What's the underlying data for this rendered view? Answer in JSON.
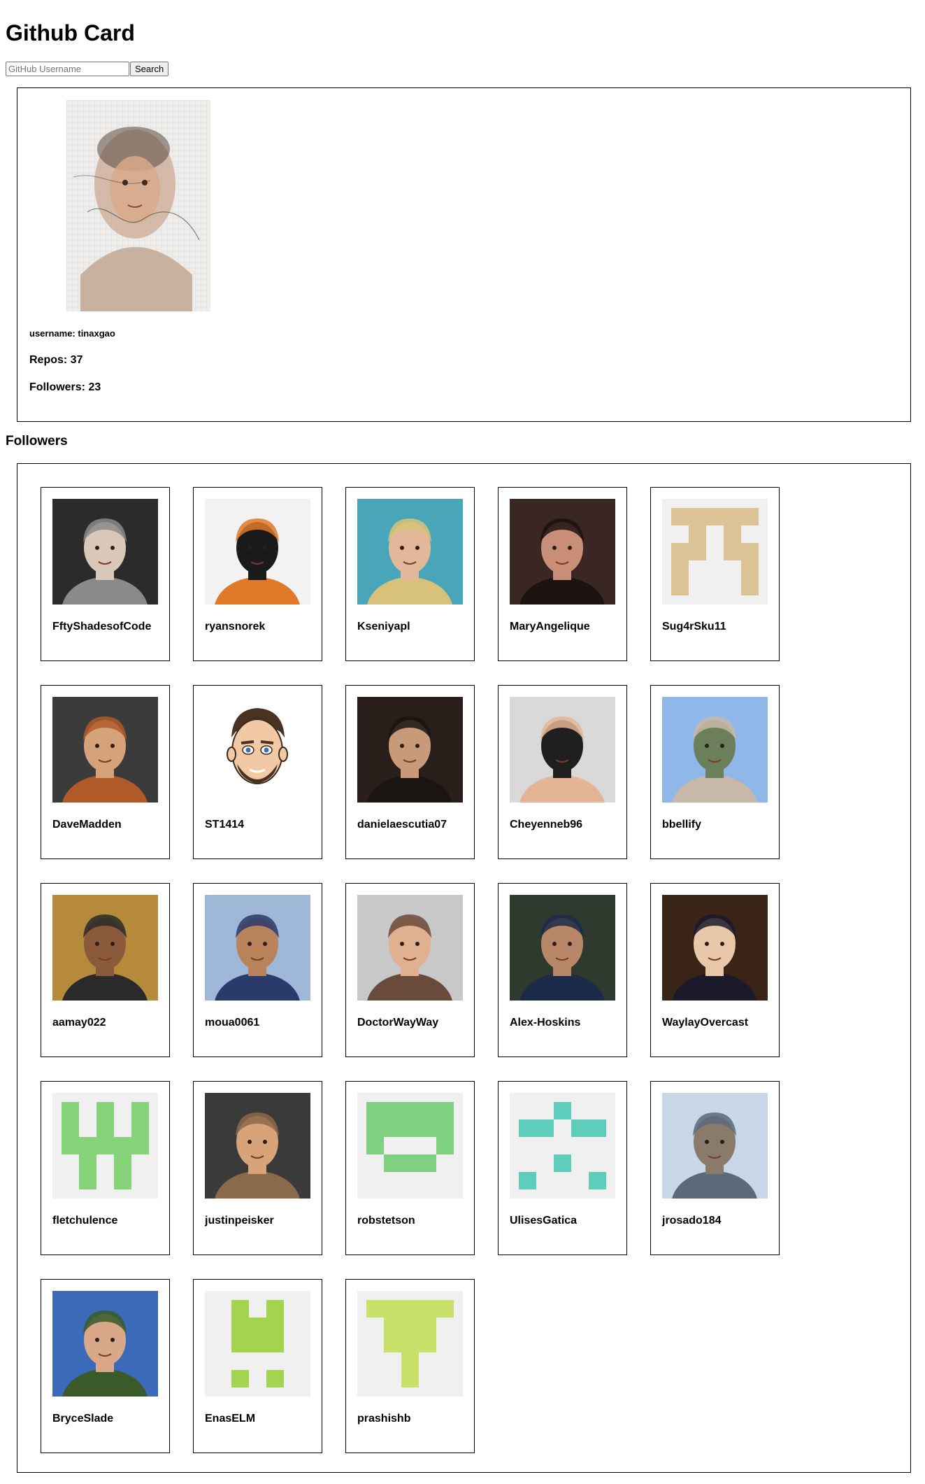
{
  "app": {
    "title": "Github Card"
  },
  "search": {
    "placeholder": "GitHub Username",
    "value": "",
    "button_label": "Search"
  },
  "profile": {
    "username_text": "username: tinaxgao",
    "repos_text": "Repos: 37",
    "followers_text": "Followers: 23"
  },
  "followers_section": {
    "heading": "Followers"
  },
  "followers": [
    {
      "login": "FftyShadesofCode",
      "avatar": "photo",
      "colors": [
        "#2b2b2b",
        "#d9c8b8",
        "#8a8a8a"
      ]
    },
    {
      "login": "ryansnorek",
      "avatar": "photo",
      "colors": [
        "#f2f2f2",
        "#1a1a1a",
        "#e07a2a"
      ]
    },
    {
      "login": "Kseniyapl",
      "avatar": "photo",
      "colors": [
        "#49a6b8",
        "#e2b89a",
        "#d8c27a"
      ]
    },
    {
      "login": "MaryAngelique",
      "avatar": "photo",
      "colors": [
        "#3a2622",
        "#c98e78",
        "#1c1210"
      ]
    },
    {
      "login": "Sug4rSku11",
      "avatar": "identicon",
      "colors": [
        "#f0f0f0",
        "#dcc396"
      ]
    },
    {
      "login": "DaveMadden",
      "avatar": "photo",
      "colors": [
        "#3b3b3b",
        "#d6a27a",
        "#b05a2a"
      ]
    },
    {
      "login": "ST1414",
      "avatar": "cartoon",
      "colors": [
        "#ffffff",
        "#f2c9a5",
        "#4a3222"
      ]
    },
    {
      "login": "danielaescutia07",
      "avatar": "photo",
      "colors": [
        "#2a1e1a",
        "#c89a7a",
        "#1a1412"
      ]
    },
    {
      "login": "Cheyenneb96",
      "avatar": "photo",
      "colors": [
        "#d9d9d9",
        "#1f1f1f",
        "#e3b596"
      ]
    },
    {
      "login": "bbellify",
      "avatar": "photo",
      "colors": [
        "#8fb7e8",
        "#6a7f5a",
        "#c8b8a8"
      ]
    },
    {
      "login": "aamay022",
      "avatar": "photo",
      "colors": [
        "#b58a3a",
        "#8a5a3a",
        "#2a2a2a"
      ]
    },
    {
      "login": "moua0061",
      "avatar": "photo",
      "colors": [
        "#9fb8d8",
        "#b8825a",
        "#2a3a6a"
      ]
    },
    {
      "login": "DoctorWayWay",
      "avatar": "photo",
      "colors": [
        "#c8c8c8",
        "#e0b090",
        "#6a4a3a"
      ]
    },
    {
      "login": "Alex-Hoskins",
      "avatar": "photo",
      "colors": [
        "#2e3a2e",
        "#b8876a",
        "#1c2a4a"
      ]
    },
    {
      "login": "WaylayOvercast",
      "avatar": "photo",
      "colors": [
        "#3a2418",
        "#e8c8a8",
        "#1a1a2a"
      ]
    },
    {
      "login": "fletchulence",
      "avatar": "identicon",
      "colors": [
        "#f0f0f0",
        "#86d37a"
      ]
    },
    {
      "login": "justinpeisker",
      "avatar": "photo",
      "colors": [
        "#3a3a3a",
        "#d9a37a",
        "#8a6a4a"
      ]
    },
    {
      "login": "robstetson",
      "avatar": "identicon",
      "colors": [
        "#f0f0f0",
        "#7fd080"
      ]
    },
    {
      "login": "UlisesGatica",
      "avatar": "identicon",
      "colors": [
        "#f0f0f0",
        "#5fcdbb"
      ]
    },
    {
      "login": "jrosado184",
      "avatar": "photo",
      "colors": [
        "#c8d8e8",
        "#8a7a6a",
        "#5a6a7a"
      ]
    },
    {
      "login": "BryceSlade",
      "avatar": "photo",
      "colors": [
        "#3a6ab8",
        "#d8a888",
        "#3a5a2a"
      ]
    },
    {
      "login": "EnasELM",
      "avatar": "identicon",
      "colors": [
        "#f0f0f0",
        "#a3d44f"
      ]
    },
    {
      "login": "prashishb",
      "avatar": "identicon",
      "colors": [
        "#f0f0f0",
        "#c9e06a"
      ]
    }
  ]
}
